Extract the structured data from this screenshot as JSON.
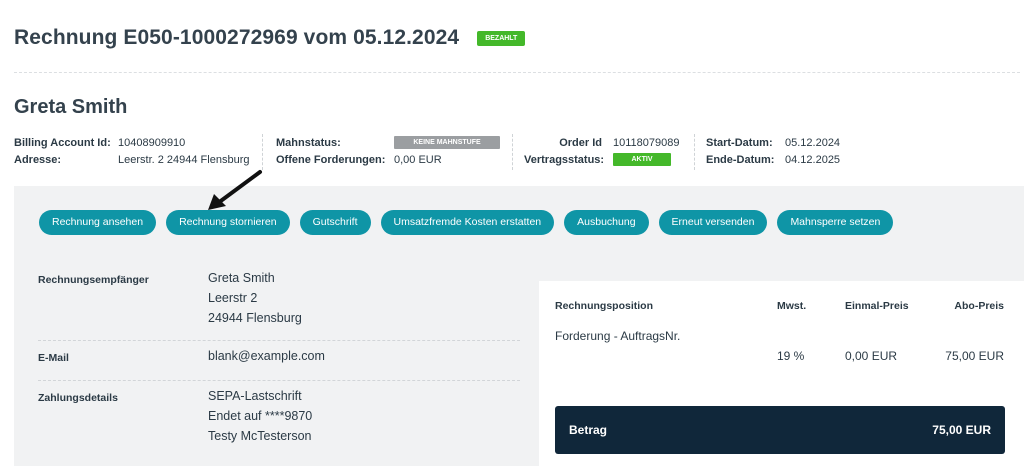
{
  "header": {
    "title": "Rechnung E050-1000272969 vom 05.12.2024",
    "status_badge": "BEZAHLT"
  },
  "customer": {
    "name": "Greta Smith"
  },
  "info": {
    "billing_account_label": "Billing Account Id:",
    "billing_account_value": "10408909910",
    "address_label": "Adresse:",
    "address_value": "Leerstr. 2 24944 Flensburg",
    "dunning_label": "Mahnstatus:",
    "dunning_badge": "KEINE MAHNSTUFE",
    "open_claims_label": "Offene Forderungen:",
    "open_claims_value": "0,00 EUR",
    "order_id_label": "Order Id",
    "order_id_value": "10118079089",
    "contract_status_label": "Vertragsstatus:",
    "contract_status_badge": "AKTIV",
    "start_label": "Start-Datum:",
    "start_value": "05.12.2024",
    "end_label": "Ende-Datum:",
    "end_value": "04.12.2025"
  },
  "actions": [
    "Rechnung ansehen",
    "Rechnung stornieren",
    "Gutschrift",
    "Umsatzfremde Kosten erstatten",
    "Ausbuchung",
    "Erneut versenden",
    "Mahnsperre setzen"
  ],
  "details": {
    "recipient_label": "Rechnungsempfänger",
    "recipient_lines": [
      "Greta Smith",
      "Leerstr 2",
      "24944 Flensburg"
    ],
    "email_label": "E-Mail",
    "email_value": "blank@example.com",
    "payment_label": "Zahlungsdetails",
    "payment_lines": [
      "SEPA-Lastschrift",
      "Endet auf ****9870",
      "Testy McTesterson"
    ]
  },
  "positions": {
    "headers": {
      "item": "Rechnungsposition",
      "vat": "Mwst.",
      "one_time": "Einmal-Preis",
      "recurring": "Abo-Preis"
    },
    "rows": [
      {
        "item": "Forderung - AuftragsNr.",
        "vat": "19 %",
        "one_time": "0,00 EUR",
        "recurring": "75,00 EUR"
      }
    ],
    "total_label": "Betrag",
    "total_value": "75,00 EUR"
  },
  "colors": {
    "accent": "#0f95a6",
    "paid_green": "#44b82a",
    "panel_gray": "#f1f2f3",
    "total_navy": "#10273a"
  }
}
